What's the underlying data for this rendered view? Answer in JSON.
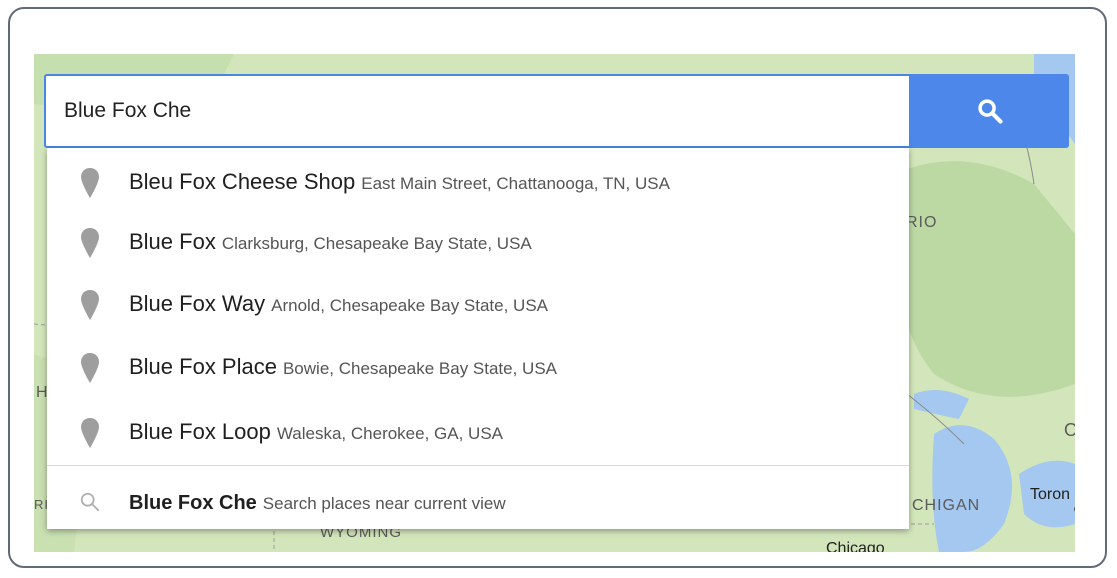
{
  "search": {
    "value": "Blue Fox Che"
  },
  "suggestions": [
    {
      "name": "Bleu Fox Cheese Shop",
      "address": "East Main Street, Chattanooga, TN, USA",
      "icon": "map-pin-icon"
    },
    {
      "name": "Blue Fox",
      "address": "Clarksburg, Chesapeake Bay State, USA",
      "icon": "map-pin-icon"
    },
    {
      "name": "Blue Fox Way",
      "address": "Arnold, Chesapeake Bay State, USA",
      "icon": "map-pin-icon"
    },
    {
      "name": "Blue Fox Place",
      "address": "Bowie, Chesapeake Bay State, USA",
      "icon": "map-pin-icon"
    },
    {
      "name": "Blue Fox Loop",
      "address": "Waleska, Cherokee, GA, USA",
      "icon": "map-pin-icon"
    }
  ],
  "search_near": {
    "query": "Blue Fox Che",
    "hint": "Search places near current view",
    "icon": "search-icon"
  },
  "map_labels": {
    "rio": "RIO",
    "o": "O",
    "h": "H",
    "ri": "RI",
    "wyoming": "WYOMING",
    "chigan": "CHIGAN",
    "toron": "Toron",
    "chicago": "Chicago"
  },
  "colors": {
    "accent": "#4d87ea",
    "map_land": "#cfe3b5",
    "map_water": "#a4c8ef",
    "pin": "#9e9e9e"
  }
}
